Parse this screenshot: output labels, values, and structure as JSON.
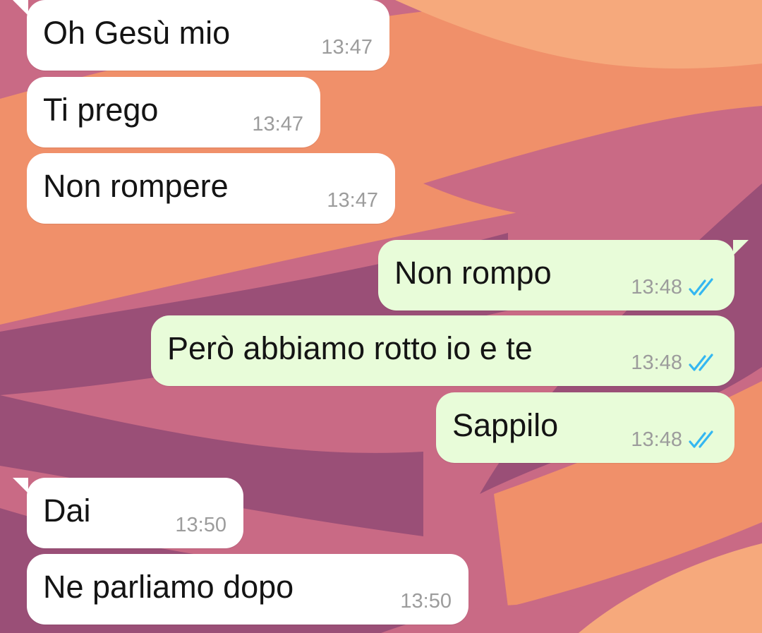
{
  "colors": {
    "incoming_bubble": "#ffffff",
    "outgoing_bubble": "#e8fcd9",
    "read_ticks": "#34b7f1",
    "timestamp": "#9c9c9c",
    "wallpaper": [
      "#c96a85",
      "#f0906a",
      "#f6a97c",
      "#9a4f77"
    ]
  },
  "messages": [
    {
      "direction": "incoming",
      "text": "Oh Gesù mio",
      "time": "13:47"
    },
    {
      "direction": "incoming",
      "text": "Ti prego",
      "time": "13:47"
    },
    {
      "direction": "incoming",
      "text": "Non rompere",
      "time": "13:47"
    },
    {
      "direction": "outgoing",
      "text": "Non rompo",
      "time": "13:48",
      "status_icon": "double-check-read-icon"
    },
    {
      "direction": "outgoing",
      "text": "Però abbiamo rotto io e te",
      "time": "13:48",
      "status_icon": "double-check-read-icon"
    },
    {
      "direction": "outgoing",
      "text": "Sappilo",
      "time": "13:48",
      "status_icon": "double-check-read-icon"
    },
    {
      "direction": "incoming",
      "text": "Dai",
      "time": "13:50"
    },
    {
      "direction": "incoming",
      "text": "Ne parliamo dopo",
      "time": "13:50"
    }
  ]
}
